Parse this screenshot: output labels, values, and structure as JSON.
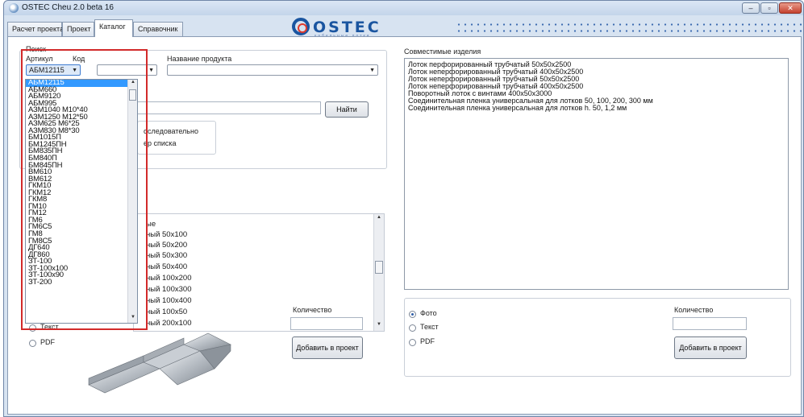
{
  "window": {
    "title": "OSTEC Cheu 2.0 beta 16",
    "controls": {
      "minimize": "–",
      "maximize": "▫",
      "close": "✕"
    }
  },
  "tabs": [
    {
      "label": "Расчет проекта"
    },
    {
      "label": "Проект"
    },
    {
      "label": "Каталог"
    },
    {
      "label": "Справочник"
    }
  ],
  "logo": {
    "text": "OSTEC",
    "sub": "кабельные лотки"
  },
  "search": {
    "group_label": "Поиск",
    "article_label": "Артикул",
    "code_label": "Код",
    "name_label": "Название продукта",
    "article_value": "АБМ12115",
    "find_button": "Найти",
    "sequential_label": "оследовательно",
    "list_label": "ер списка"
  },
  "dropdown": {
    "items": [
      "АБМ12115",
      "АБМ660",
      "АБМ9120",
      "АБМ995",
      "АЗМ1040 М10*40",
      "АЗМ1250 М12*50",
      "АЗМ625 М6*25",
      "АЗМ830 М8*30",
      "БМ1015П",
      "БМ1245ПН",
      "БМ835ПН",
      "БМ840П",
      "БМ845ПН",
      "ВМ610",
      "ВМ612",
      "ГКМ10",
      "ГКМ12",
      "ГКМ8",
      "ГМ10",
      "ГМ12",
      "ГМ6",
      "ГМ6С5",
      "ГМ8",
      "ГМ8С5",
      "ДГ640",
      "ДГ860",
      "ЗТ-100",
      "ЗТ-100х100",
      "ЗТ-100х90",
      "ЗТ-200"
    ],
    "selected_index": 0
  },
  "product_list": {
    "header": "ые",
    "rows": [
      "ный 50x100",
      "ный 50x200",
      "ный 50x300",
      "ный 50x400",
      "ный 100x200",
      "ный 100x300",
      "ный 100x400",
      "ный 100x50",
      "ный 200x100"
    ]
  },
  "left_bottom": {
    "quantity_label": "Количество",
    "add_button": "Добавить в проект",
    "text_option": "Текст",
    "pdf_option": "PDF"
  },
  "related": {
    "title": "Совместимые изделия",
    "items": [
      "Лоток перфорированный трубчатый 50x50x2500",
      "Лоток неперфорированный трубчатый 400x50x2500",
      "Лоток неперфорированный трубчатый 50x50x2500",
      "Лоток неперфорированный трубчатый 400x50x2500",
      "Поворотный лоток с винтами 400x50x3000",
      "Соединительная пленка универсальная для лотков 50, 100, 200, 300 мм",
      "Соединительная пленка универсальная для лотков h. 50, 1,2 мм"
    ]
  },
  "right_bottom": {
    "photo_option": "Фото",
    "text_option": "Текст",
    "pdf_option": "PDF",
    "quantity_label": "Количество",
    "add_button": "Добавить в проект"
  },
  "colors": {
    "selection": "#3399ff",
    "highlight_border": "#d22a2a",
    "brand_blue": "#1a55a0"
  }
}
